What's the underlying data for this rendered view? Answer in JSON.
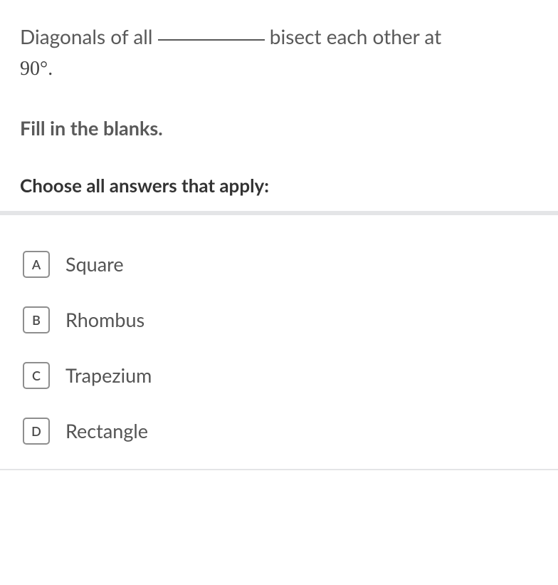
{
  "question": {
    "part1": "Diagonals of all ",
    "part2": " bisect each other at",
    "degree": "90°.",
    "instruction": "Fill in the blanks.",
    "choose_prompt": "Choose all answers that apply:"
  },
  "options": [
    {
      "letter": "A",
      "label": "Square"
    },
    {
      "letter": "B",
      "label": "Rhombus"
    },
    {
      "letter": "C",
      "label": "Trapezium"
    },
    {
      "letter": "D",
      "label": "Rectangle"
    }
  ]
}
